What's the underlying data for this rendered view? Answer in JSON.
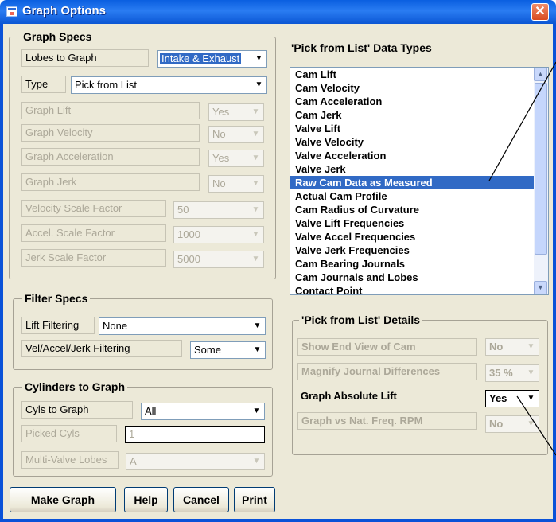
{
  "window": {
    "title": "Graph Options",
    "close_glyph": "✕",
    "icon": "app-window-icon"
  },
  "graph_specs": {
    "title": "Graph Specs",
    "lobes_label": "Lobes to Graph",
    "lobes_value": "Intake & Exhaust",
    "type_label": "Type",
    "type_value": "Pick from List",
    "lift_label": "Graph Lift",
    "lift_value": "Yes",
    "velocity_label": "Graph Velocity",
    "velocity_value": "No",
    "accel_label": "Graph Acceleration",
    "accel_value": "Yes",
    "jerk_label": "Graph Jerk",
    "jerk_value": "No",
    "vel_scale_label": "Velocity Scale Factor",
    "vel_scale_value": "50",
    "accel_scale_label": "Accel. Scale Factor",
    "accel_scale_value": "1000",
    "jerk_scale_label": "Jerk Scale Factor",
    "jerk_scale_value": "5000"
  },
  "filter_specs": {
    "title": "Filter Specs",
    "lift_filter_label": "Lift Filtering",
    "lift_filter_value": "None",
    "vaj_filter_label": "Vel/Accel/Jerk Filtering",
    "vaj_filter_value": "Some"
  },
  "cylinders": {
    "title": "Cylinders to Graph",
    "cyls_label": "Cyls to Graph",
    "cyls_value": "All",
    "picked_label": "Picked Cyls",
    "picked_value": "1",
    "multivalve_label": "Multi-Valve Lobes",
    "multivalve_value": "A"
  },
  "buttons": {
    "make_graph": "Make Graph",
    "help": "Help",
    "cancel": "Cancel",
    "print": "Print"
  },
  "data_types": {
    "title": "'Pick from List' Data Types",
    "items": [
      "Cam Lift",
      "Cam Velocity",
      "Cam Acceleration",
      "Cam Jerk",
      "Valve Lift",
      "Valve Velocity",
      "Valve Acceleration",
      "Valve Jerk",
      "Raw Cam Data as Measured",
      "Actual Cam Profile",
      "Cam Radius of Curvature",
      "Valve Lift Frequencies",
      "Valve Accel Frequencies",
      "Valve Jerk Frequencies",
      "Cam Bearing Journals",
      "Cam Journals and Lobes",
      "Contact Point"
    ],
    "selected_index": 8
  },
  "details": {
    "title": "'Pick from List' Details",
    "end_view_label": "Show End View of Cam",
    "end_view_value": "No",
    "magnify_label": "Magnify Journal Differences",
    "magnify_value": "35 %",
    "abs_lift_label": "Graph Absolute Lift",
    "abs_lift_value": "Yes",
    "nat_freq_label": "Graph vs Nat. Freq. RPM",
    "nat_freq_value": "No"
  },
  "colors": {
    "title_bar": "#0a5fe0",
    "selection": "#316ac5",
    "dialog_bg": "#ece9d8",
    "disabled_text": "#aca899"
  }
}
